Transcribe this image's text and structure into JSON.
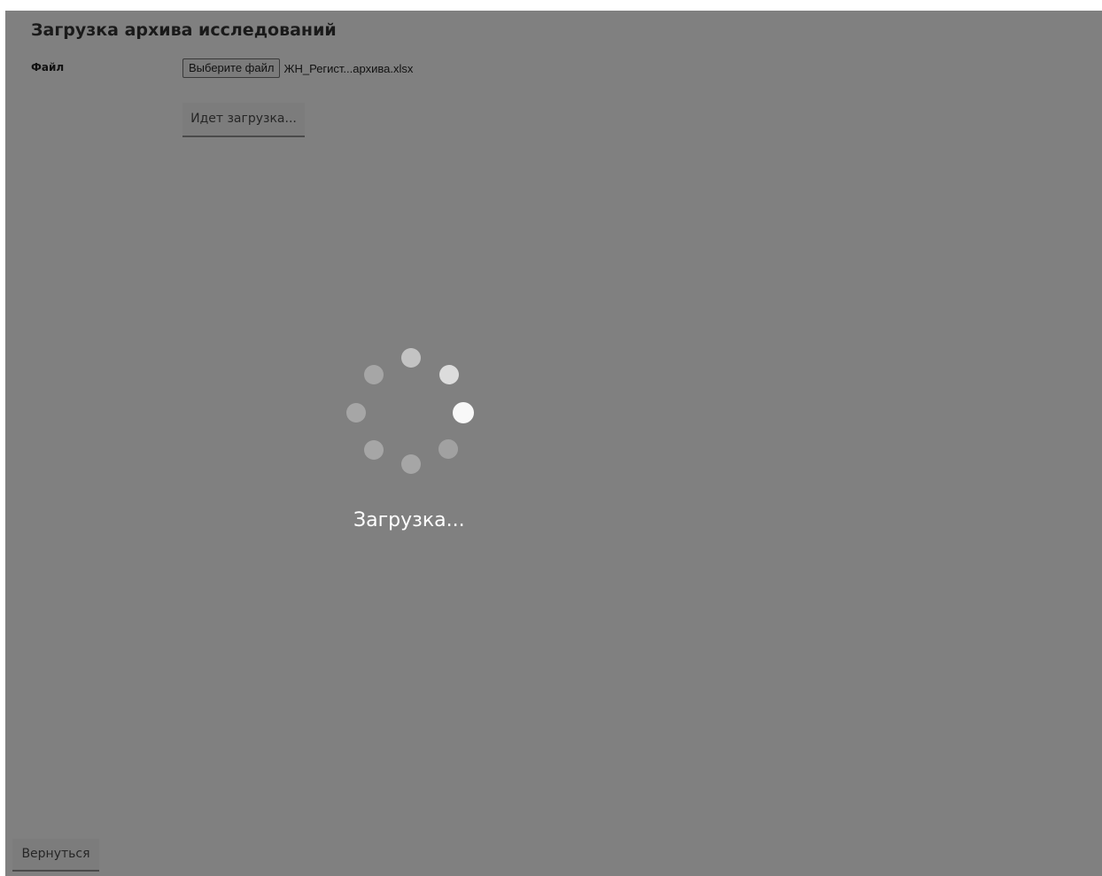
{
  "page": {
    "title": "Загрузка архива исследований"
  },
  "form": {
    "file_label": "Файл",
    "choose_file_label": "Выберите файл",
    "selected_file_name": "ЖН_Регист...архива.xlsx",
    "upload_button_label": "Идет загрузка..."
  },
  "loading": {
    "text": "Загрузка...",
    "spinner_icon": "loading-spinner-icon"
  },
  "footer": {
    "back_label": "Вернуться"
  },
  "colors": {
    "overlay": "#808080",
    "spinner_active": "#f8f8f8",
    "spinner_inactive": "#a6a6a6"
  }
}
